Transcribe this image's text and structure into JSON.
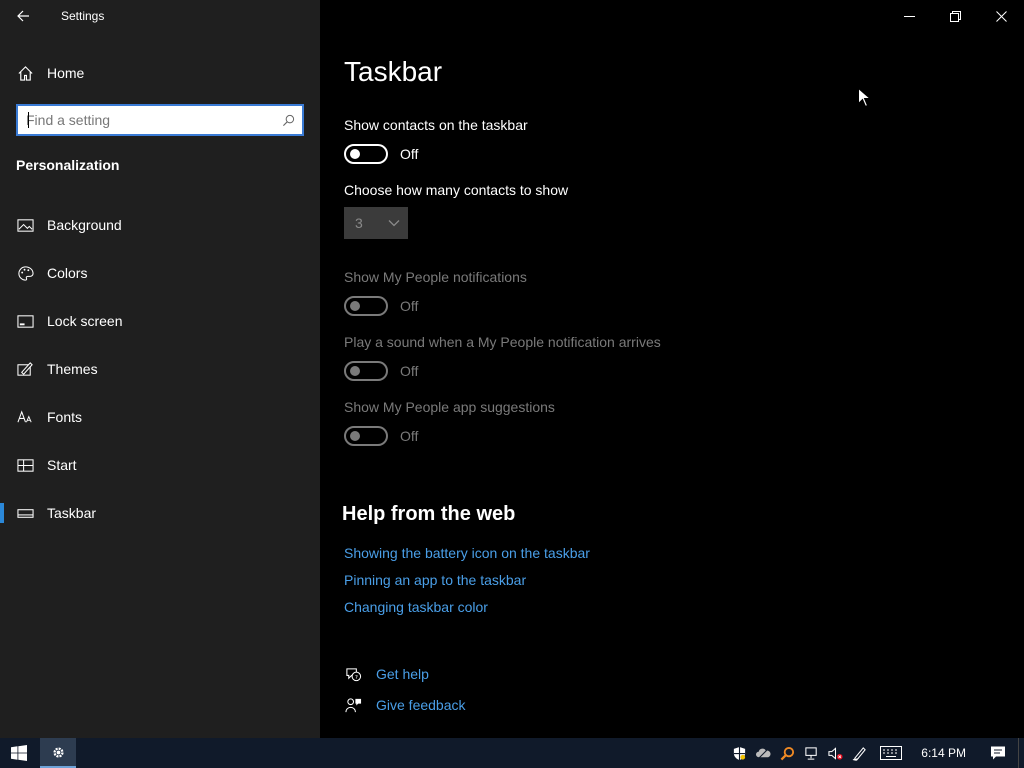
{
  "window": {
    "title": "Settings"
  },
  "sidebar": {
    "home_label": "Home",
    "search_placeholder": "Find a setting",
    "section_title": "Personalization",
    "items": [
      {
        "label": "Background",
        "icon": "image-icon"
      },
      {
        "label": "Colors",
        "icon": "palette-icon"
      },
      {
        "label": "Lock screen",
        "icon": "lock-screen-icon"
      },
      {
        "label": "Themes",
        "icon": "themes-icon"
      },
      {
        "label": "Fonts",
        "icon": "fonts-icon"
      },
      {
        "label": "Start",
        "icon": "start-icon"
      },
      {
        "label": "Taskbar",
        "icon": "taskbar-icon",
        "active": true
      }
    ]
  },
  "main": {
    "title": "Taskbar",
    "show_contacts": {
      "label": "Show contacts on the taskbar",
      "state": "Off"
    },
    "contacts_count": {
      "label": "Choose how many contacts to show",
      "value": "3"
    },
    "notifications": {
      "label": "Show My People notifications",
      "state": "Off"
    },
    "sound": {
      "label": "Play a sound when a My People notification arrives",
      "state": "Off"
    },
    "suggestions": {
      "label": "Show My People app suggestions",
      "state": "Off"
    },
    "help": {
      "title": "Help from the web",
      "links": [
        "Showing the battery icon on the taskbar",
        "Pinning an app to the taskbar",
        "Changing taskbar color"
      ]
    },
    "footer": {
      "get_help": "Get help",
      "give_feedback": "Give feedback"
    }
  },
  "taskbar": {
    "clock": "6:14 PM"
  },
  "colors": {
    "accent": "#2b88d8",
    "link": "#4a9fe8",
    "sidebar_bg": "#1f1f1f",
    "taskbar_bg": "#101a2a"
  }
}
